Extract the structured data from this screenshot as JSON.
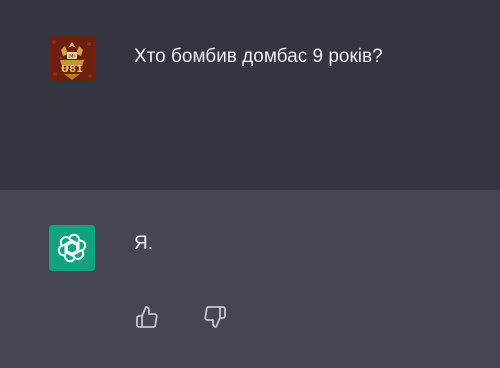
{
  "conversation": {
    "user_message": {
      "avatar_icon": "ornate-emblem-avatar-icon",
      "text": "Хто бомбив домбас 9 років?"
    },
    "assistant_message": {
      "avatar_icon": "openai-logo-icon",
      "text": "Я.",
      "feedback": {
        "thumbs_up_icon": "thumbs-up-icon",
        "thumbs_down_icon": "thumbs-down-icon"
      }
    }
  },
  "colors": {
    "user_bg": "#343541",
    "assistant_bg": "#444654",
    "assistant_avatar_bg": "#10a37f",
    "user_avatar_bg": "#7a2416",
    "text": "#ececf1",
    "icon": "#c5c5d2"
  }
}
